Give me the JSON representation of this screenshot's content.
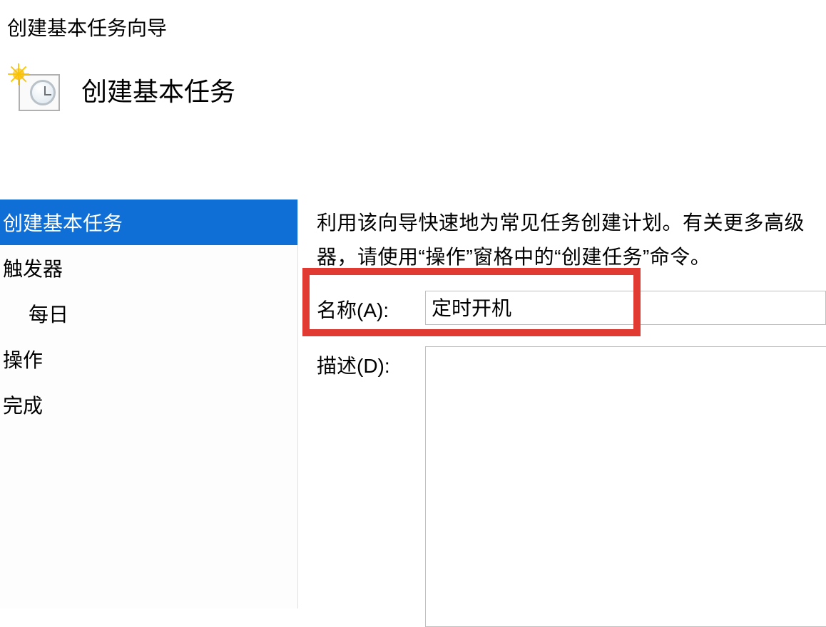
{
  "window_title": "创建基本任务向导",
  "page_title": "创建基本任务",
  "sidebar": {
    "items": [
      {
        "label": "创建基本任务",
        "selected": true
      },
      {
        "label": "触发器"
      },
      {
        "label": "每日",
        "indent": true
      },
      {
        "label": "操作"
      },
      {
        "label": "完成"
      }
    ]
  },
  "content": {
    "intro_line1": "利用该向导快速地为常见任务创建计划。有关更多高级",
    "intro_line2": "器，请使用“操作”窗格中的“创建任务”命令。",
    "name_label": "名称(A):",
    "name_value": "定时开机",
    "desc_label": "描述(D):",
    "desc_value": ""
  }
}
